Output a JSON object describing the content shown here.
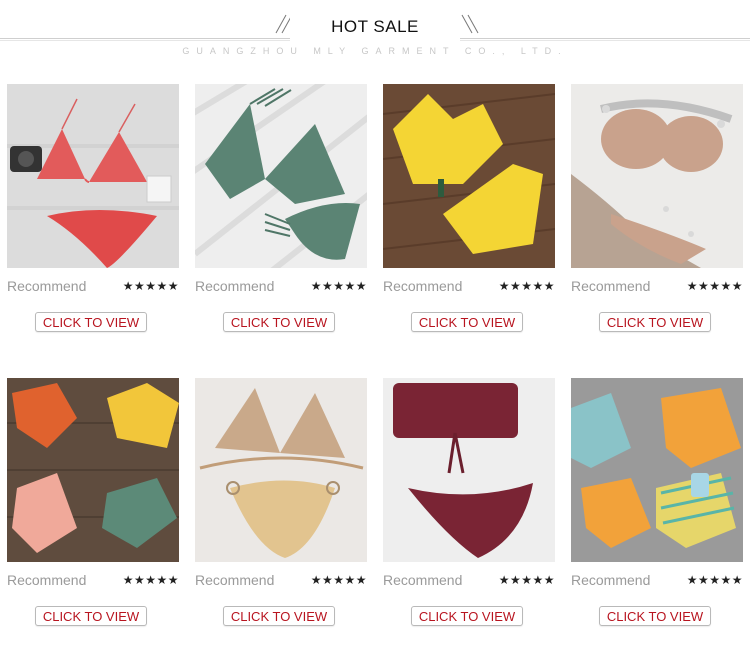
{
  "header": {
    "title": "HOT SALE",
    "subtitle": "GUANGZHOU MLY GARMENT CO., LTD."
  },
  "products": [
    {
      "recommend_label": "Recommend",
      "rating_stars": "★★★★★",
      "rating": 5,
      "cta_label": "CLICK TO VIEW"
    },
    {
      "recommend_label": "Recommend",
      "rating_stars": "★★★★★",
      "rating": 5,
      "cta_label": "CLICK TO VIEW"
    },
    {
      "recommend_label": "Recommend",
      "rating_stars": "★★★★★",
      "rating": 5,
      "cta_label": "CLICK TO VIEW"
    },
    {
      "recommend_label": "Recommend",
      "rating_stars": "★★★★★",
      "rating": 5,
      "cta_label": "CLICK TO VIEW"
    },
    {
      "recommend_label": "Recommend",
      "rating_stars": "★★★★★",
      "rating": 5,
      "cta_label": "CLICK TO VIEW"
    },
    {
      "recommend_label": "Recommend",
      "rating_stars": "★★★★★",
      "rating": 5,
      "cta_label": "CLICK TO VIEW"
    },
    {
      "recommend_label": "Recommend",
      "rating_stars": "★★★★★",
      "rating": 5,
      "cta_label": "CLICK TO VIEW"
    },
    {
      "recommend_label": "Recommend",
      "rating_stars": "★★★★★",
      "rating": 5,
      "cta_label": "CLICK TO VIEW"
    }
  ],
  "colors": {
    "cta_text": "#b8141f",
    "recommend_text": "#9a9a9a"
  }
}
